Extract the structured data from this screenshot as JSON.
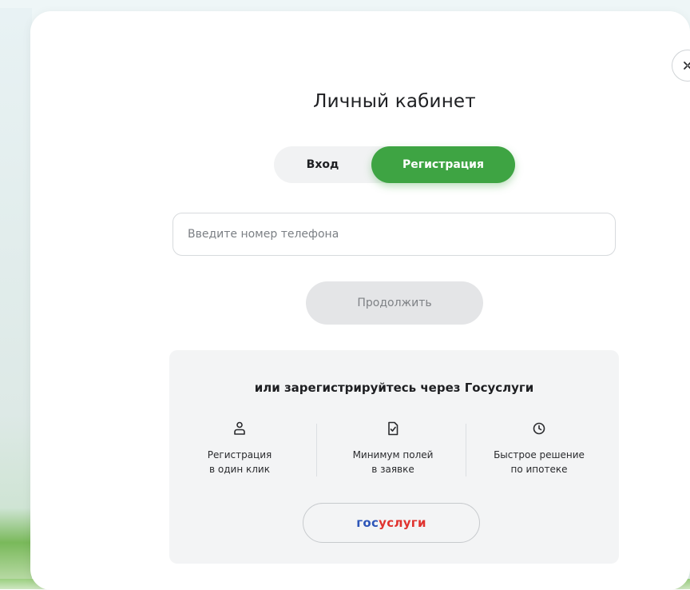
{
  "modal": {
    "title": "Личный кабинет",
    "close_icon": "close-icon"
  },
  "tabs": {
    "login_label": "Вход",
    "register_label": "Регистрация",
    "active": "register"
  },
  "phone": {
    "placeholder": "Введите номер телефона",
    "value": ""
  },
  "continue_label": "Продолжить",
  "gosuslugi": {
    "heading": "или зарегистрируйтесь через Госуслуги",
    "features": [
      {
        "icon": "user-icon",
        "line1": "Регистрация",
        "line2": "в один клик"
      },
      {
        "icon": "document-check-icon",
        "line1": "Минимум полей",
        "line2": "в заявке"
      },
      {
        "icon": "clock-icon",
        "line1": "Быстрое решение",
        "line2": "по ипотеке"
      }
    ],
    "button_part1": "гос",
    "button_part2": "услуги"
  },
  "colors": {
    "accent_green": "#3ea443",
    "gos_blue": "#2d55b8",
    "gos_red": "#e0332f"
  }
}
